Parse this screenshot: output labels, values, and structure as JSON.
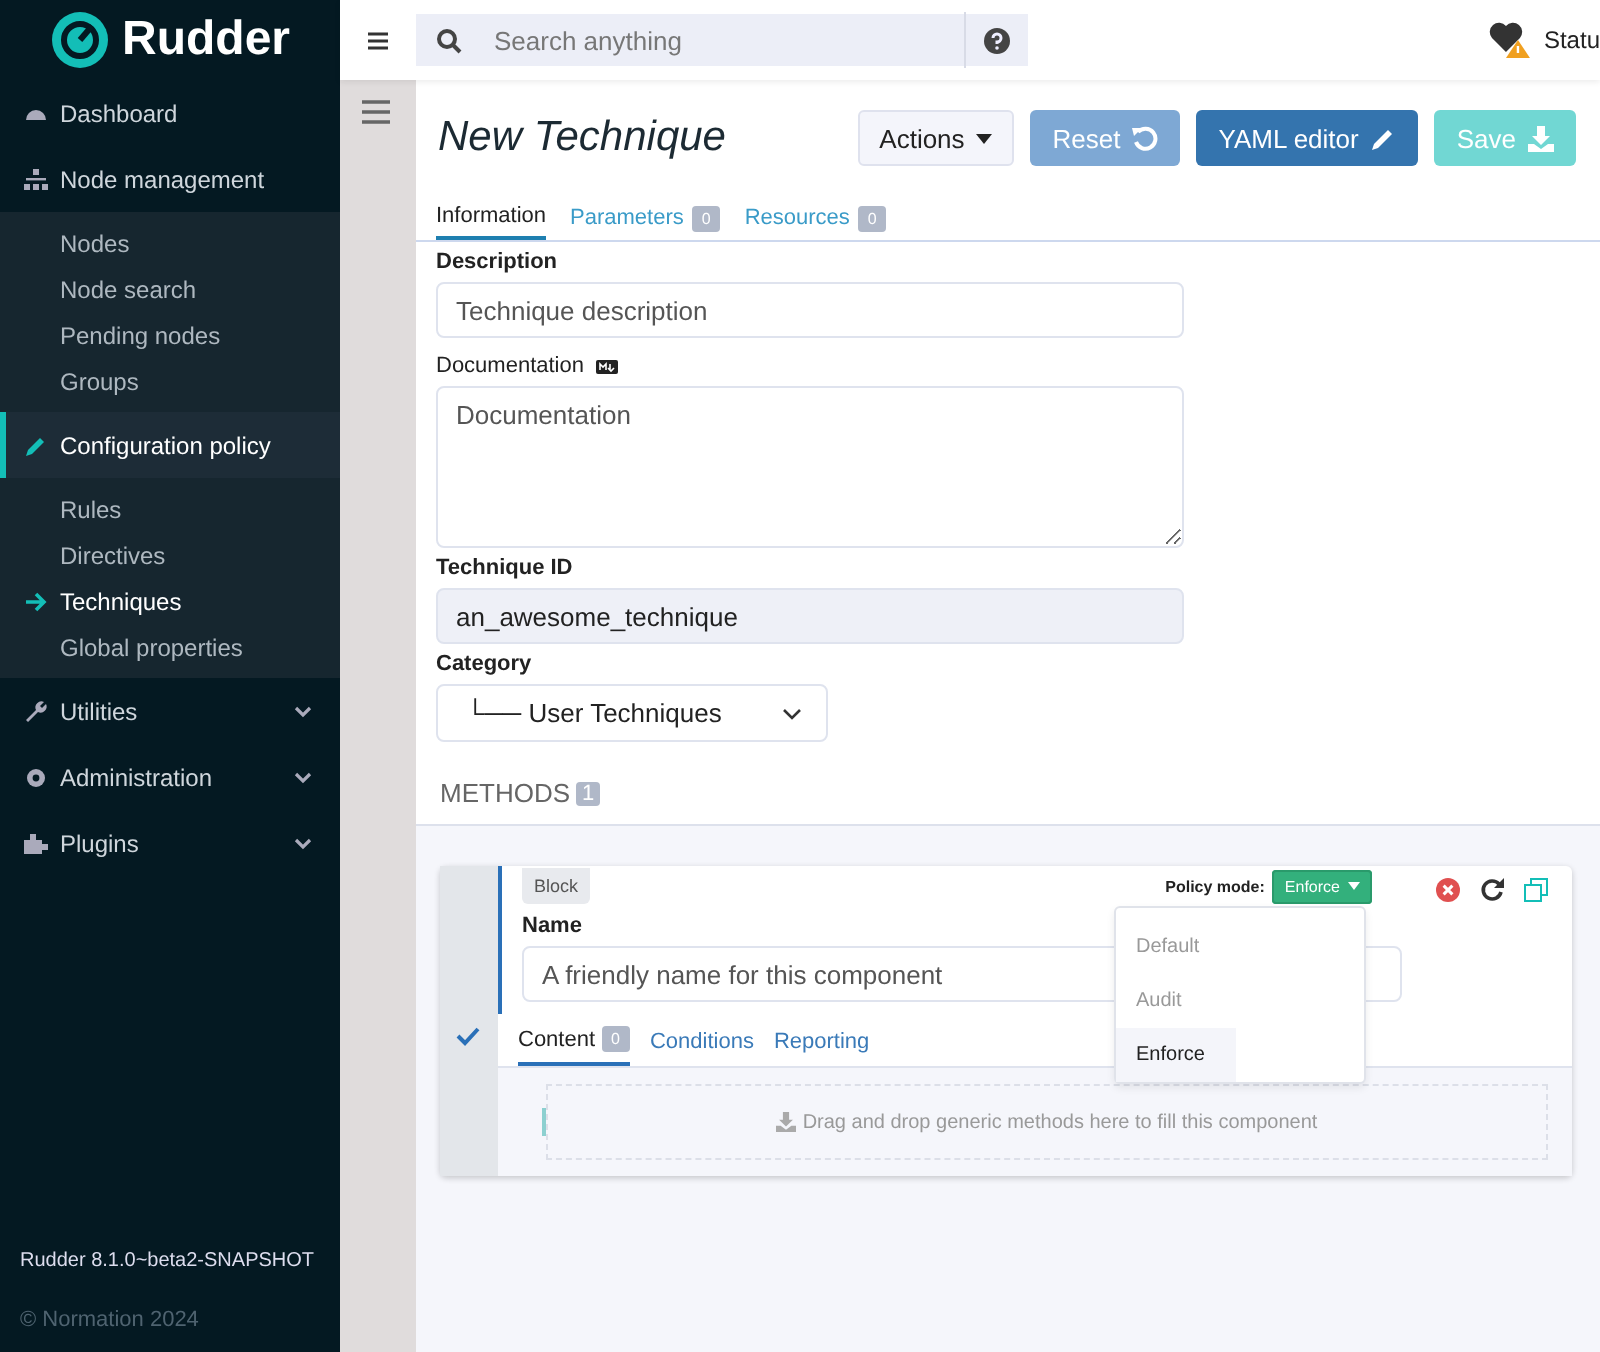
{
  "sidebar": {
    "logo": "Rudder",
    "items": [
      {
        "label": "Dashboard",
        "selected": false
      },
      {
        "label": "Node management",
        "selected": false,
        "expanded": true,
        "children": [
          {
            "label": "Nodes",
            "selected": false
          },
          {
            "label": "Node search",
            "selected": false
          },
          {
            "label": "Pending nodes",
            "selected": false
          },
          {
            "label": "Groups",
            "selected": false
          }
        ]
      },
      {
        "label": "Configuration policy",
        "selected": true,
        "expanded": true,
        "children": [
          {
            "label": "Rules",
            "selected": false
          },
          {
            "label": "Directives",
            "selected": false
          },
          {
            "label": "Techniques",
            "selected": true
          },
          {
            "label": "Global properties",
            "selected": false
          }
        ]
      },
      {
        "label": "Utilities",
        "selected": false,
        "expanded": false
      },
      {
        "label": "Administration",
        "selected": false,
        "expanded": false
      },
      {
        "label": "Plugins",
        "selected": false,
        "expanded": false
      }
    ],
    "version": "Rudder 8.1.0~beta2-SNAPSHOT",
    "copyright": "© Normation 2024"
  },
  "topbar": {
    "search": {
      "placeholder": "Search anything"
    },
    "status": "Statu"
  },
  "header": {
    "title": "New Technique",
    "buttons": [
      {
        "label": "Actions",
        "kind": "dropdown",
        "disabled": false
      },
      {
        "label": "Reset",
        "kind": "reset",
        "disabled": true
      },
      {
        "label": "YAML editor",
        "kind": "edit",
        "disabled": false
      },
      {
        "label": "Save",
        "kind": "save",
        "disabled": true
      }
    ]
  },
  "tabs": [
    {
      "label": "Information",
      "selected": true
    },
    {
      "label": "Parameters",
      "count": "0",
      "selected": false
    },
    {
      "label": "Resources",
      "count": "0",
      "selected": false
    }
  ],
  "form": {
    "description_label": "Description",
    "description_placeholder": "Technique description",
    "documentation_label": "Documentation",
    "documentation_placeholder": "Documentation",
    "id_label": "Technique ID",
    "id_value": "an_awesome_technique",
    "category_label": "Category",
    "category_value": "└── User Techniques"
  },
  "methods": {
    "title": "METHODS",
    "count": "1",
    "block": {
      "tag": "Block",
      "policy_label": "Policy mode:",
      "policy_value": "Enforce",
      "menu_open": true,
      "policy_options": [
        {
          "label": "Default",
          "selected": false
        },
        {
          "label": "Audit",
          "selected": false
        },
        {
          "label": "Enforce",
          "selected": true
        }
      ],
      "name_label": "Name",
      "name_placeholder": "A friendly name for this component",
      "tabs": [
        {
          "label": "Content",
          "count": "0",
          "selected": true
        },
        {
          "label": "Conditions",
          "selected": false
        },
        {
          "label": "Reporting",
          "selected": false
        }
      ],
      "dropzone": "Drag and drop generic methods here to fill this component",
      "valid": true
    }
  }
}
